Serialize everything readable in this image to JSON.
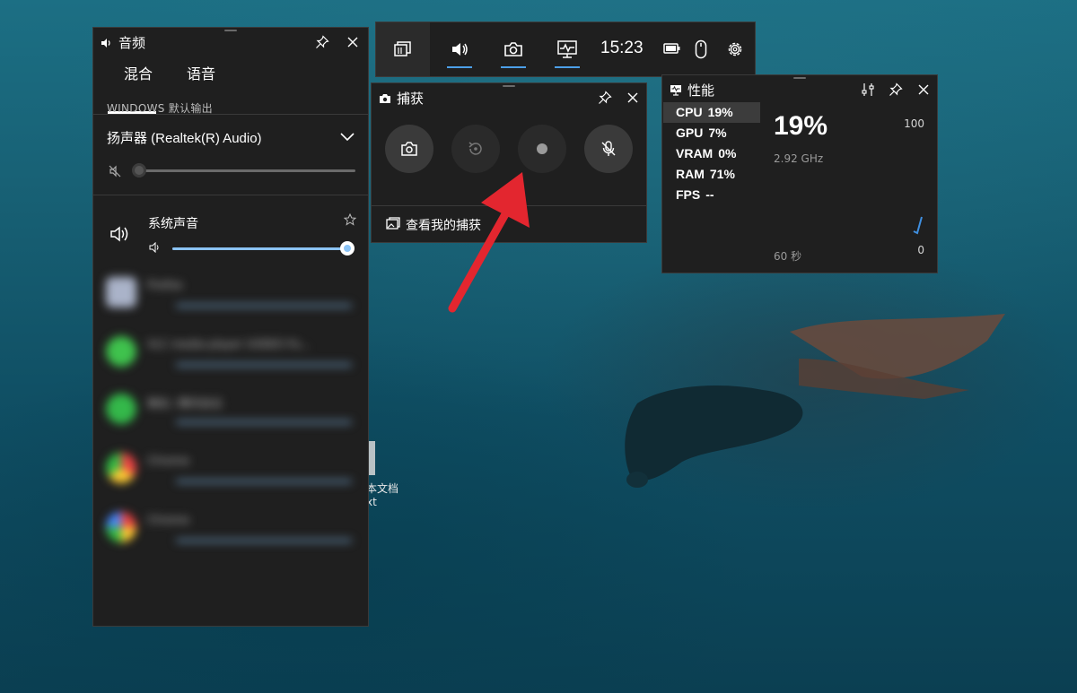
{
  "colors": {
    "panel_bg": "#1f1f1f",
    "accent": "#4c9fe8",
    "slider_fill": "#8bc3f5",
    "arrow": "#e3262f"
  },
  "gamebar": {
    "time": "15:23",
    "icons": [
      "widget-menu-icon",
      "audio-icon",
      "capture-icon",
      "performance-icon",
      "battery-icon",
      "mouse-icon",
      "settings-icon"
    ]
  },
  "audio": {
    "title": "音频",
    "tabs": [
      {
        "label": "混合",
        "selected": true
      },
      {
        "label": "语音",
        "selected": false
      }
    ],
    "section_label": "WINDOWS 默认输出",
    "output_device": "扬声器 (Realtek(R) Audio)",
    "device_volume": 0,
    "system_sound": {
      "label": "系统声音",
      "volume": 1.0
    },
    "blurred_apps": [
      "Firefox",
      "VLC media player (VIDEO Fo...",
      "微信 / 腾讯会议",
      "Chrome",
      "Chrome"
    ]
  },
  "capture": {
    "title": "捕获",
    "view_link": "查看我的捕获",
    "buttons": [
      "screenshot",
      "record-last-30s",
      "start-recording",
      "microphone-off"
    ]
  },
  "performance": {
    "title": "性能",
    "stats": [
      {
        "name": "CPU",
        "value": "19%",
        "selected": true
      },
      {
        "name": "GPU",
        "value": "7%",
        "selected": false
      },
      {
        "name": "VRAM",
        "value": "0%",
        "selected": false
      },
      {
        "name": "RAM",
        "value": "71%",
        "selected": false
      },
      {
        "name": "FPS",
        "value": "--",
        "selected": false
      }
    ],
    "big_value": "19%",
    "frequency": "2.92 GHz",
    "axis_max": "100",
    "axis_min": "0",
    "time_window": "60 秒"
  },
  "desktop": {
    "file_label_line1": "本文档",
    "file_label_line2": "xt"
  }
}
